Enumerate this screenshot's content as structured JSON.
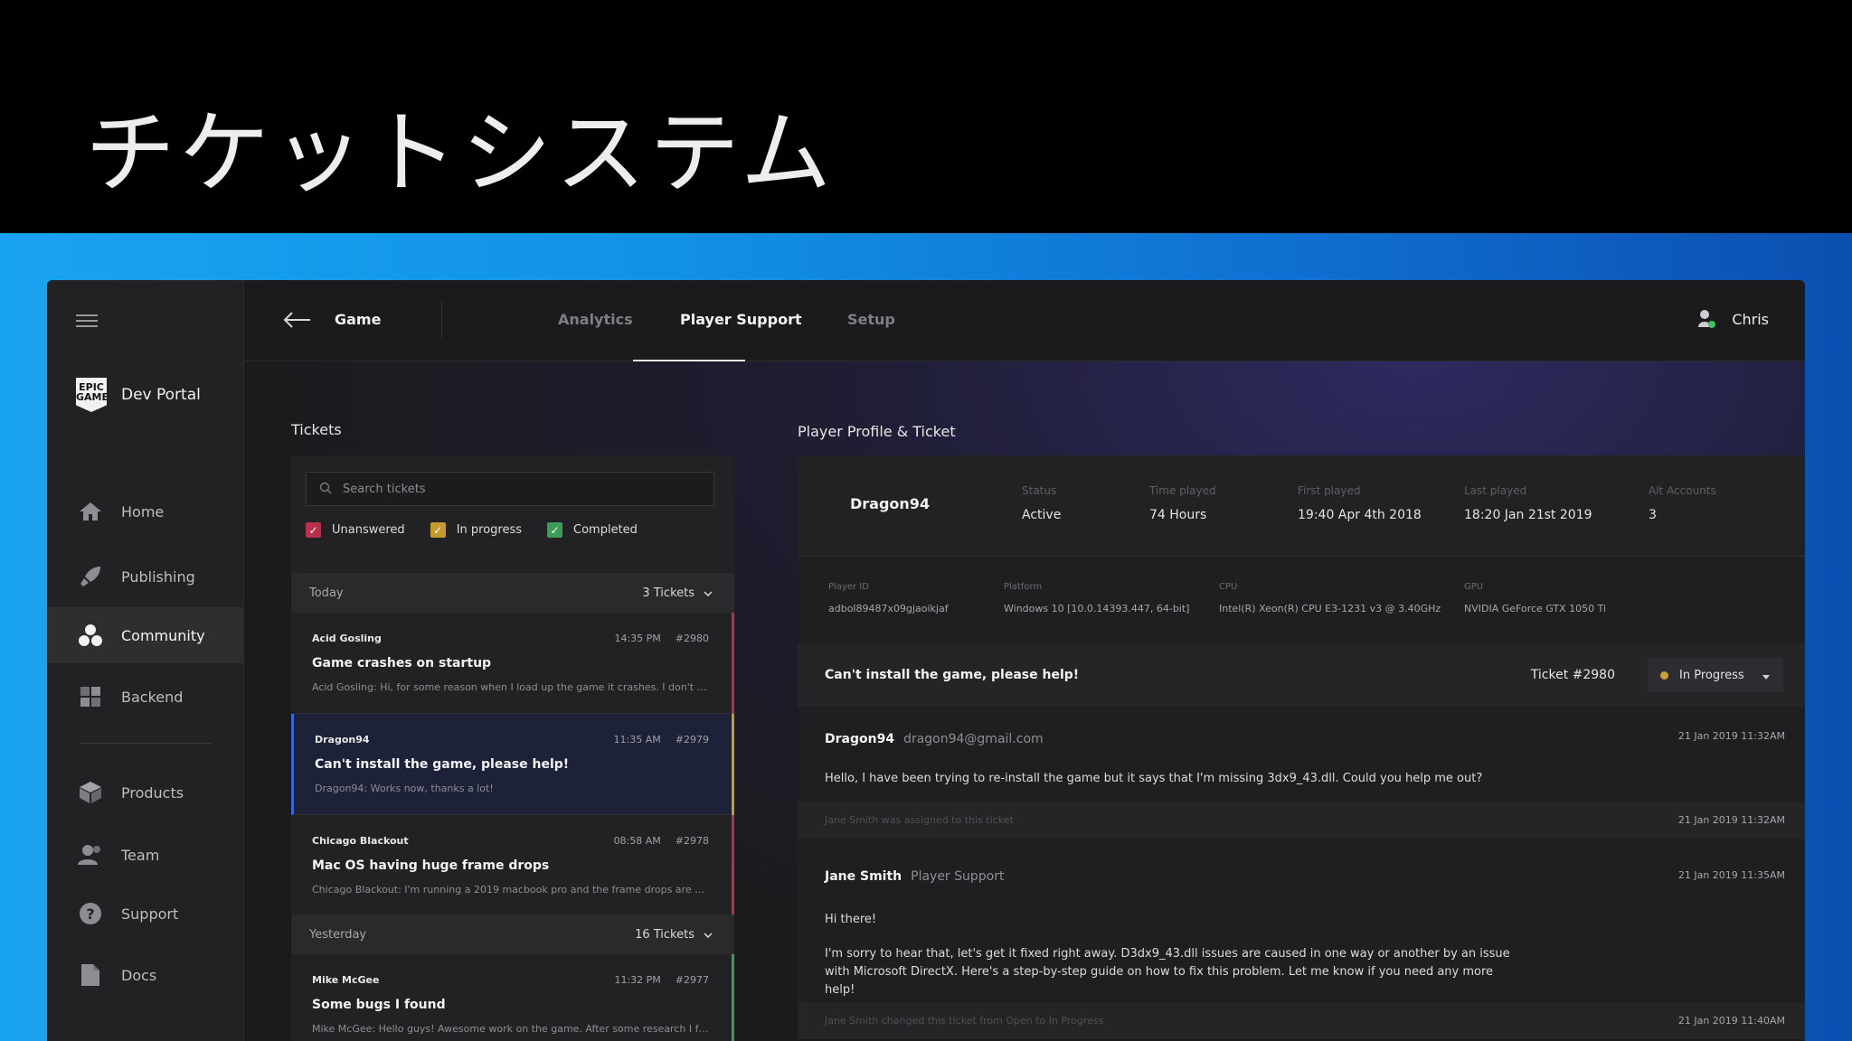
{
  "banner": {
    "title": "チケットシステム"
  },
  "sidebar": {
    "brand": "Dev Portal",
    "items": [
      {
        "label": "Home",
        "icon": "home-icon"
      },
      {
        "label": "Publishing",
        "icon": "rocket-icon"
      },
      {
        "label": "Community",
        "icon": "community-icon",
        "active": true
      },
      {
        "label": "Backend",
        "icon": "backend-icon"
      },
      {
        "label": "Products",
        "icon": "box-icon"
      },
      {
        "label": "Team",
        "icon": "team-icon"
      },
      {
        "label": "Support",
        "icon": "help-icon"
      },
      {
        "label": "Docs",
        "icon": "document-icon"
      }
    ]
  },
  "topbar": {
    "game": "Game",
    "tabs": [
      "Analytics",
      "Player Support",
      "Setup"
    ],
    "active_tab": "Player Support",
    "user": "Chris"
  },
  "tickets": {
    "section_label": "Tickets",
    "search_placeholder": "Search tickets",
    "filters": [
      {
        "label": "Unanswered",
        "color": "#b7314a"
      },
      {
        "label": "In progress",
        "color": "#c39a2e"
      },
      {
        "label": "Completed",
        "color": "#3e9b5a"
      }
    ],
    "groups": [
      {
        "label": "Today",
        "count": "3 Tickets"
      },
      {
        "label": "Yesterday",
        "count": "16 Tickets"
      }
    ],
    "items": [
      {
        "author": "Acid Gosling",
        "time": "14:35 PM",
        "id": "#2980",
        "title": "Game crashes on startup",
        "preview": "Acid Gosling:  Hi, for some reason when I load up the game it crashes. I don't kn...",
        "status_color": "#b7314a"
      },
      {
        "author": "Dragon94",
        "time": "11:35 AM",
        "id": "#2979",
        "title": "Can't install the game, please help!",
        "preview": "Dragon94: Works now, thanks a lot!",
        "status_color": "#c39a2e"
      },
      {
        "author": "Chicago Blackout",
        "time": "08:58 AM",
        "id": "#2978",
        "title": "Mac OS having huge frame drops",
        "preview": "Chicago Blackout: I'm running a 2019 macbook pro and the frame drops are killin...",
        "status_color": "#b7314a"
      },
      {
        "author": "Mike McGee",
        "time": "11:32 PM",
        "id": "#2977",
        "title": "Some bugs I found",
        "preview": "Mike McGee:  Hello guys! Awesome work on the game. After some research I foun...",
        "status_color": "#3e9b5a"
      }
    ]
  },
  "profile": {
    "section_label": "Player Profile & Ticket",
    "name": "Dragon94",
    "stats": [
      {
        "label": "Status",
        "value": "Active"
      },
      {
        "label": "Time played",
        "value": "74 Hours"
      },
      {
        "label": "First played",
        "value": "19:40 Apr 4th 2018"
      },
      {
        "label": "Last played",
        "value": "18:20 Jan 21st 2019"
      },
      {
        "label": "Alt Accounts",
        "value": "3"
      }
    ],
    "system": [
      {
        "label": "Player ID",
        "value": "adbol89487x09gjaoikjaf"
      },
      {
        "label": "Platform",
        "value": "Windows 10 [10.0.14393.447, 64-bit]"
      },
      {
        "label": "CPU",
        "value": "Intel(R) Xeon(R) CPU E3-1231 v3 @ 3.40GHz"
      },
      {
        "label": "GPU",
        "value": "NVIDIA GeForce GTX 1050 Ti"
      }
    ]
  },
  "ticket": {
    "title": "Can't install the game, please help!",
    "number": "Ticket #2980",
    "status": "In Progress",
    "messages": [
      {
        "author": "Dragon94",
        "sub": "dragon94@gmail.com",
        "time": "21 Jan 2019 11:32AM",
        "body": "Hello, I have been trying to re-install the game but it says that I'm missing 3dx9_43.dll. Could you help me out?"
      },
      {
        "author": "Jane Smith",
        "sub": "Player Support",
        "time": "21 Jan 2019 11:35AM",
        "body1": "Hi there!",
        "body2": "I'm sorry to hear that, let's get it fixed right away. D3dx9_43.dll issues are caused in one way or another by an issue with Microsoft DirectX. Here's a step-by-step guide on how to fix this problem. Let me know if you need any more help!"
      }
    ],
    "events": [
      {
        "text": "Jane Smith was assigned to this ticket",
        "time": "21 Jan 2019 11:32AM"
      },
      {
        "text": "Jane Smith changed this ticket from Open to In Progress",
        "time": "21 Jan 2019 11:40AM"
      }
    ]
  }
}
